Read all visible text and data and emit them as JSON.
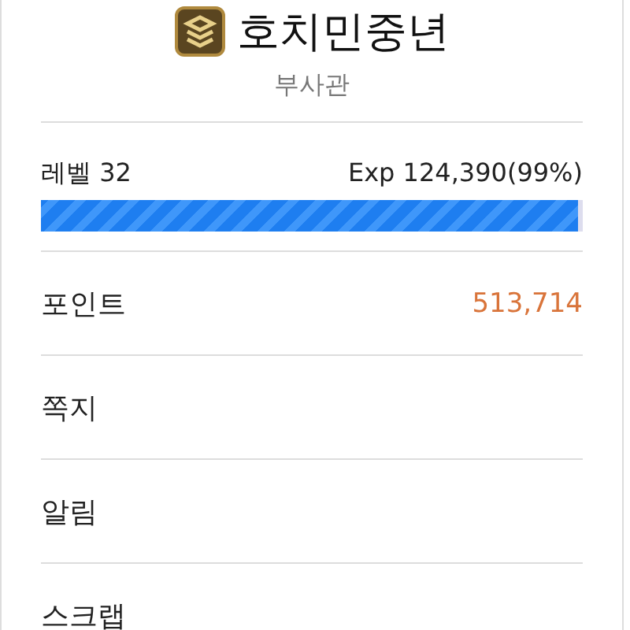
{
  "profile": {
    "name": "호치민중년",
    "rank": "부사관"
  },
  "level": {
    "label": "레벨 32",
    "exp": "Exp 124,390(99%)",
    "level": 0.99
  },
  "menu": [
    {
      "label": "포인트",
      "value": "513,714"
    },
    {
      "label": "쪽지"
    },
    {
      "label": "알림"
    },
    {
      "label": "스크랩"
    }
  ]
}
